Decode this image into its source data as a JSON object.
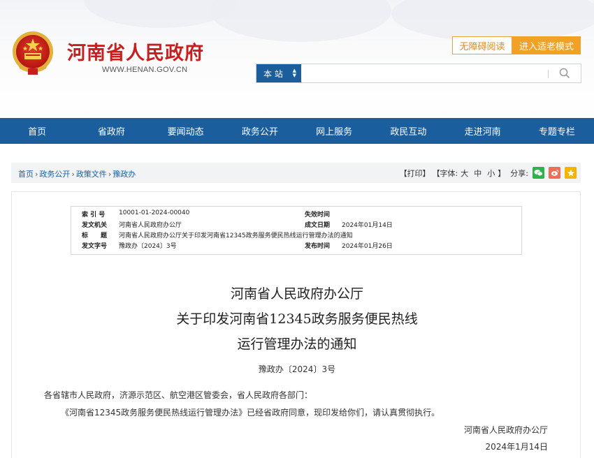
{
  "header": {
    "site_title": "河南省人民政府",
    "site_url": "WWW.HENAN.GOV.CN",
    "accessibility_button": "无障碍阅读",
    "elder_mode_button": "进入适老模式",
    "search": {
      "scope_label": "本 站",
      "placeholder": ""
    }
  },
  "nav": {
    "items": [
      "首页",
      "省政府",
      "要闻动态",
      "政务公开",
      "网上服务",
      "政民互动",
      "走进河南",
      "专题专栏"
    ]
  },
  "breadcrumb": {
    "items": [
      "首页",
      "政务公开",
      "政策文件",
      "豫政办"
    ]
  },
  "tools": {
    "print": "【打印】",
    "font_label": "【字体:",
    "font_large": "大",
    "font_medium": "中",
    "font_small": "小",
    "font_close": "】",
    "share_label": "分享:"
  },
  "meta": {
    "index_label": "索 引 号",
    "index_value": "10001-01-2024-00040",
    "expiry_label": "失效时间",
    "expiry_value": "",
    "issuer_label": "发文机关",
    "issuer_value": "河南省人民政府办公厅",
    "date_label": "成文日期",
    "date_value": "2024年01月14日",
    "title_label": "标　　题",
    "title_value": "河南省人民政府办公厅关于印发河南省12345政务服务便民热线运行管理办法的通知",
    "docno_label": "发文字号",
    "docno_value": "豫政办〔2024〕3号",
    "publish_label": "发布时间",
    "publish_value": "2024年01月26日"
  },
  "document": {
    "title_line1": "河南省人民政府办公厅",
    "title_line2": "关于印发河南省12345政务服务便民热线",
    "title_line3": "运行管理办法的通知",
    "number": "豫政办〔2024〕3号",
    "salutation": "各省辖市人民政府，济源示范区、航空港区管委会，省人民政府各部门：",
    "body": "《河南省12345政务服务便民热线运行管理办法》已经省政府同意，现印发给你们，请认真贯彻执行。",
    "signature": "河南省人民政府办公厅",
    "date": "2024年1月14日"
  },
  "colors": {
    "brand_blue": "#1a5e9e",
    "title_red": "#c81e1e",
    "accent_orange": "#f2a127"
  },
  "icons": [
    "national-emblem-icon",
    "search-icon",
    "wechat-icon",
    "weibo-icon",
    "favorite-star-icon",
    "sort-arrows-icon"
  ]
}
